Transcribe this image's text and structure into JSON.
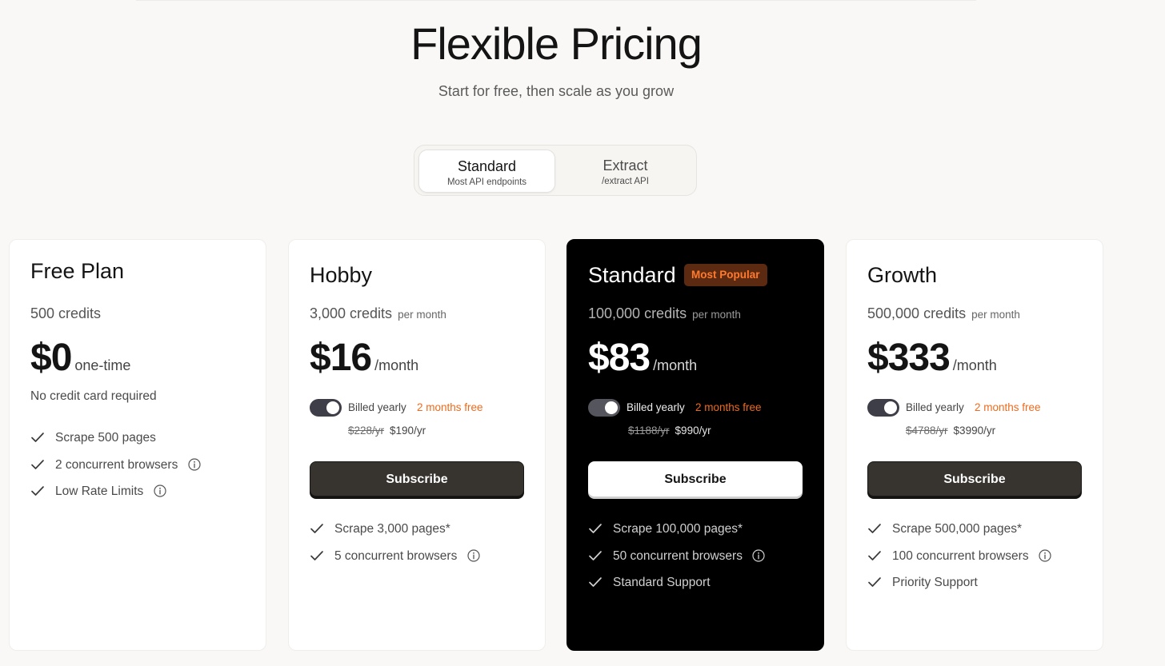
{
  "header": {
    "title": "Flexible Pricing",
    "subtitle": "Start for free, then scale as you grow"
  },
  "product_toggle": {
    "options": [
      {
        "label": "Standard",
        "sublabel": "Most API endpoints",
        "selected": true
      },
      {
        "label": "Extract",
        "sublabel": "/extract API",
        "selected": false
      }
    ]
  },
  "colors": {
    "accent": "#ee6a1d",
    "badge_bg": "#5c2a10",
    "dark_card": "#000000",
    "button_dark": "#37332f"
  },
  "plans": [
    {
      "name": "Free Plan",
      "credits": "500 credits",
      "credits_period": "",
      "price": "$0",
      "price_unit": "one-time",
      "note": "No credit card required",
      "features": [
        {
          "text": "Scrape 500 pages",
          "info": false
        },
        {
          "text": "2 concurrent browsers",
          "info": true
        },
        {
          "text": "Low Rate Limits",
          "info": true
        }
      ]
    },
    {
      "name": "Hobby",
      "credits": "3,000 credits",
      "credits_period": "per month",
      "price": "$16",
      "price_unit": "/month",
      "billing_label": "Billed yearly",
      "billing_promo": "2 months free",
      "billed_yearly_on": true,
      "old_yearly": "$228/yr",
      "new_yearly": "$190/yr",
      "cta": "Subscribe",
      "features": [
        {
          "text": "Scrape 3,000 pages*",
          "info": false
        },
        {
          "text": "5 concurrent browsers",
          "info": true
        }
      ]
    },
    {
      "name": "Standard",
      "badge": "Most Popular",
      "credits": "100,000 credits",
      "credits_period": "per month",
      "price": "$83",
      "price_unit": "/month",
      "billing_label": "Billed yearly",
      "billing_promo": "2 months free",
      "billed_yearly_on": true,
      "old_yearly": "$1188/yr",
      "new_yearly": "$990/yr",
      "cta": "Subscribe",
      "features": [
        {
          "text": "Scrape 100,000 pages*",
          "info": false
        },
        {
          "text": "50 concurrent browsers",
          "info": true
        },
        {
          "text": "Standard Support",
          "info": false
        }
      ]
    },
    {
      "name": "Growth",
      "credits": "500,000 credits",
      "credits_period": "per month",
      "price": "$333",
      "price_unit": "/month",
      "billing_label": "Billed yearly",
      "billing_promo": "2 months free",
      "billed_yearly_on": true,
      "old_yearly": "$4788/yr",
      "new_yearly": "$3990/yr",
      "cta": "Subscribe",
      "features": [
        {
          "text": "Scrape 500,000 pages*",
          "info": false
        },
        {
          "text": "100 concurrent browsers",
          "info": true
        },
        {
          "text": "Priority Support",
          "info": false
        }
      ]
    }
  ]
}
